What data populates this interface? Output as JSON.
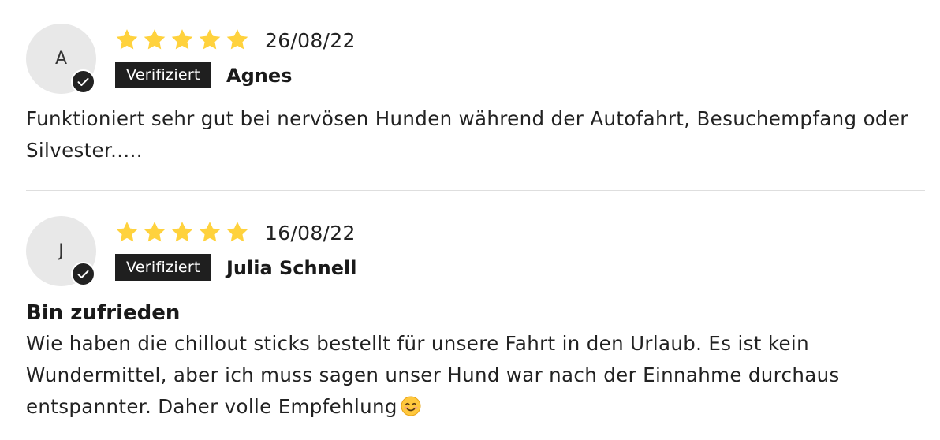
{
  "colors": {
    "star": "#FFD23D",
    "badge_bg": "#1f1f1f",
    "avatar_bg": "#e8e8e8",
    "divider": "#dedede"
  },
  "reviews": [
    {
      "initial": "A",
      "rating": 5,
      "date": "26/08/22",
      "badge": "Verifiziert",
      "author": "Agnes",
      "title": "",
      "body": "Funktioniert sehr gut bei nervösen Hunden während der Autofahrt, Besuchempfang oder Silvester....."
    },
    {
      "initial": "J",
      "rating": 5,
      "date": "16/08/22",
      "badge": "Verifiziert",
      "author": "Julia Schnell",
      "title": "Bin zufrieden",
      "body": "Wie haben die chillout sticks bestellt für unsere Fahrt in den Urlaub. Es ist kein Wundermittel, aber ich muss sagen unser Hund war nach der Einnahme durchaus entspannter. Daher volle Empfehlung",
      "emoji": "smiling-face-emoji"
    }
  ]
}
